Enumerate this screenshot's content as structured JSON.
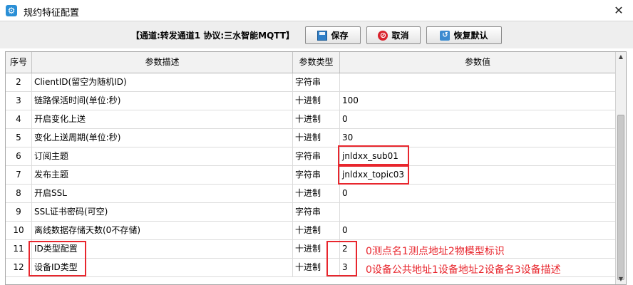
{
  "window": {
    "title": "规约特征配置",
    "close_glyph": "✕"
  },
  "toolbar": {
    "protocol_label": "【通道:转发通道1  协议:三水智能MQTT】",
    "save_label": "保存",
    "cancel_label": "取消",
    "reset_label": "恢复默认"
  },
  "table": {
    "headers": [
      "序号",
      "参数描述",
      "参数类型",
      "参数值"
    ],
    "rows": [
      {
        "no": "2",
        "desc": "ClientID(留空为随机ID)",
        "type": "字符串",
        "value": ""
      },
      {
        "no": "3",
        "desc": "链路保活时间(单位:秒)",
        "type": "十进制",
        "value": "100"
      },
      {
        "no": "4",
        "desc": "开启变化上送",
        "type": "十进制",
        "value": "0"
      },
      {
        "no": "5",
        "desc": "变化上送周期(单位:秒)",
        "type": "十进制",
        "value": "30"
      },
      {
        "no": "6",
        "desc": "订阅主题",
        "type": "字符串",
        "value": "jnldxx_sub01"
      },
      {
        "no": "7",
        "desc": "发布主题",
        "type": "字符串",
        "value": "jnldxx_topic03"
      },
      {
        "no": "8",
        "desc": "开启SSL",
        "type": "十进制",
        "value": "0"
      },
      {
        "no": "9",
        "desc": "SSL证书密码(可空)",
        "type": "字符串",
        "value": ""
      },
      {
        "no": "10",
        "desc": "离线数据存储天数(0不存储)",
        "type": "十进制",
        "value": "0"
      },
      {
        "no": "11",
        "desc": "ID类型配置",
        "type": "十进制",
        "value": "2"
      },
      {
        "no": "12",
        "desc": "设备ID类型",
        "type": "十进制",
        "value": "3"
      }
    ]
  },
  "annotations": {
    "id_type_note": "0测点名1测点地址2物模型标识",
    "device_id_note": "0设备公共地址1设备地址2设备名3设备描述",
    "color": "#e8262d"
  },
  "icons": {
    "app": "gear-icon",
    "save": "floppy-disk-icon",
    "cancel": "no-entry-icon",
    "reset": "restore-icon"
  }
}
